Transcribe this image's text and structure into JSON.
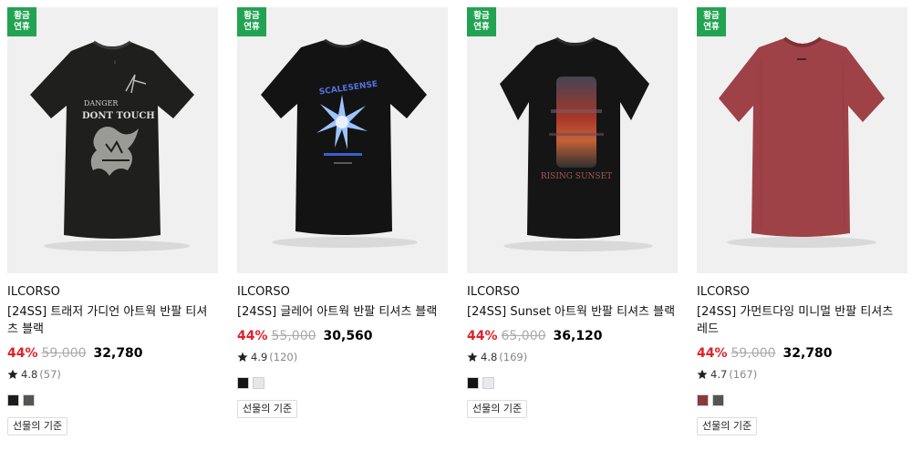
{
  "products": [
    {
      "badge": [
        "황금",
        "연휴"
      ],
      "brand": "ILCORSO",
      "title": "[24SS] 트래저 가디언 아트웍 반팔 티셔츠 블랙",
      "discount": "44%",
      "original_price": "59,000",
      "price": "32,780",
      "rating": "4.8",
      "review_count": "(57)",
      "swatches": [
        "#1c1c1c",
        "#545451"
      ],
      "gift_label": "선물의 기준",
      "shirt_color": "#1e1e1c",
      "print_text": [
        "DANGER",
        "DONT TOUCH"
      ]
    },
    {
      "badge": [
        "황금",
        "연휴"
      ],
      "brand": "ILCORSO",
      "title": "[24SS] 글레어 아트웍 반팔 티셔츠 블랙",
      "discount": "44%",
      "original_price": "55,000",
      "price": "30,560",
      "rating": "4.9",
      "review_count": "(120)",
      "swatches": [
        "#141414",
        "#e6e6ee"
      ],
      "gift_label": "선물의 기준",
      "shirt_color": "#121212",
      "print_text": [
        "SCALESENSE"
      ]
    },
    {
      "badge": [
        "황금",
        "연휴"
      ],
      "brand": "ILCORSO",
      "title": "[24SS] Sunset 아트웍 반팔 티셔츠 블랙",
      "discount": "44%",
      "original_price": "65,000",
      "price": "36,120",
      "rating": "4.8",
      "review_count": "(169)",
      "swatches": [
        "#141414",
        "#e9e9ef"
      ],
      "gift_label": "선물의 기준",
      "shirt_color": "#151515",
      "print_text": [
        "RISING SUNSET"
      ]
    },
    {
      "badge": [
        "황금",
        "연휴"
      ],
      "brand": "ILCORSO",
      "title": "[24SS] 가먼트다잉 미니멀 반팔 티셔츠 레드",
      "discount": "44%",
      "original_price": "59,000",
      "price": "32,780",
      "rating": "4.7",
      "review_count": "(167)",
      "swatches": [
        "#8a3a3c",
        "#545451"
      ],
      "gift_label": "선물의 기준",
      "shirt_color": "#9c4146",
      "print_text": []
    }
  ],
  "colors": {
    "badge": "#22a352",
    "discount": "#e0202a"
  },
  "icons": {
    "rating": "star-icon"
  }
}
